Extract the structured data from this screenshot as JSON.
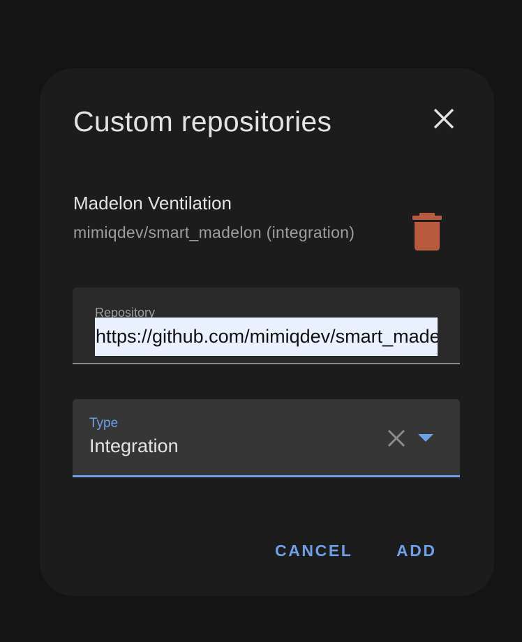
{
  "dialog": {
    "title": "Custom repositories",
    "close_icon": "close-icon"
  },
  "repositories": [
    {
      "name": "Madelon Ventilation",
      "subtitle": "mimiqdev/smart_madelon (integration)",
      "delete_icon": "trash-icon",
      "delete_icon_color": "#b85a3e"
    }
  ],
  "repository_field": {
    "label": "Repository",
    "value": "https://github.com/mimiqdev/smart_madelon"
  },
  "type_field": {
    "label": "Type",
    "selected": "Integration",
    "clear_icon": "clear-icon",
    "dropdown_icon": "caret-down-icon"
  },
  "actions": {
    "cancel_label": "CANCEL",
    "add_label": "ADD"
  },
  "colors": {
    "accent": "#6ea0e6",
    "dialog_background": "#1c1c1c",
    "page_background": "#141414",
    "delete": "#b85a3e"
  }
}
